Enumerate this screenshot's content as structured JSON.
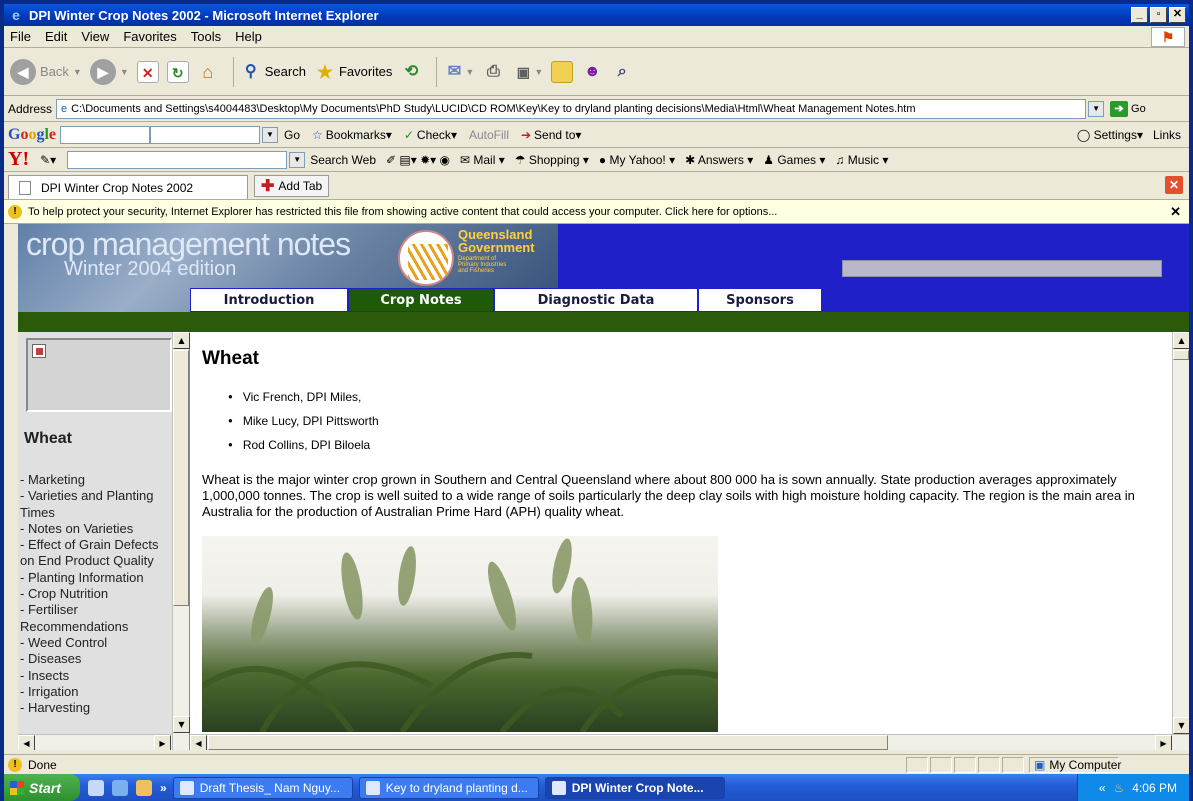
{
  "window": {
    "title": "DPI Winter Crop Notes 2002 - Microsoft Internet Explorer",
    "minimize": "_",
    "restore": "▫",
    "close": "✕"
  },
  "menu": [
    "File",
    "Edit",
    "View",
    "Favorites",
    "Tools",
    "Help"
  ],
  "toolbar": {
    "back": "Back",
    "search": "Search",
    "favorites": "Favorites"
  },
  "address": {
    "label": "Address",
    "url": "C:\\Documents and Settings\\s4004483\\Desktop\\My Documents\\PhD Study\\LUCID\\CD ROM\\Key\\Key to dryland planting decisions\\Media\\Html\\Wheat Management Notes.htm",
    "go": "Go"
  },
  "googlebar": {
    "logo": "Google",
    "go": "Go",
    "bookmarks": "Bookmarks",
    "check": "Check",
    "autofill": "AutoFill",
    "sendto": "Send to",
    "settings": "Settings",
    "links": "Links"
  },
  "yahoobar": {
    "logo": "Y!",
    "search_web": "Search Web",
    "mail": "Mail",
    "shopping": "Shopping",
    "my_yahoo": "My Yahoo!",
    "answers": "Answers",
    "games": "Games",
    "music": "Music"
  },
  "tabs": {
    "active": "DPI Winter Crop Notes 2002",
    "add": "Add Tab"
  },
  "infobar": {
    "text": "To help protect your security, Internet Explorer has restricted this file from showing active content that could access your computer. Click here for options..."
  },
  "site": {
    "title": "crop management notes",
    "edition": "Winter 2004 edition",
    "gov_name": "Queensland",
    "gov_line": "Government",
    "dept": "Department of Primary Industries and Fisheries",
    "nav": [
      "Introduction",
      "Crop Notes",
      "Diagnostic Data",
      "Sponsors"
    ],
    "active_nav": "Crop Notes"
  },
  "left": {
    "title": "Wheat",
    "links": [
      "- Marketing",
      "- Varieties and Planting Times",
      "- Notes on Varieties",
      "- Effect of Grain Defects on End Product Quality",
      "- Planting Information",
      "- Crop Nutrition",
      "- Fertiliser Recommendations",
      "- Weed Control",
      "- Diseases",
      "- Insects",
      "- Irrigation",
      "- Harvesting"
    ]
  },
  "main": {
    "title": "Wheat",
    "authors": [
      "Vic French, DPI Miles,",
      "Mike Lucy, DPI Pittsworth",
      "Rod Collins, DPI Biloela"
    ],
    "paragraph": "Wheat is the major winter crop grown in Southern and Central Queensland where about 800 000 ha is sown annually. State production averages approximately 1,000,000 tonnes. The crop is well suited to a wide range of soils particularly the deep clay soils with high moisture holding capacity. The region is the main area in Australia for the production of Australian Prime Hard (APH) quality wheat."
  },
  "status": {
    "text": "Done",
    "zone": "My Computer"
  },
  "taskbar": {
    "start": "Start",
    "tasks": [
      "Draft Thesis_ Nam Nguy...",
      "Key to dryland planting d...",
      "DPI Winter Crop Note..."
    ],
    "active_task": 2,
    "clock": "4:06 PM"
  }
}
